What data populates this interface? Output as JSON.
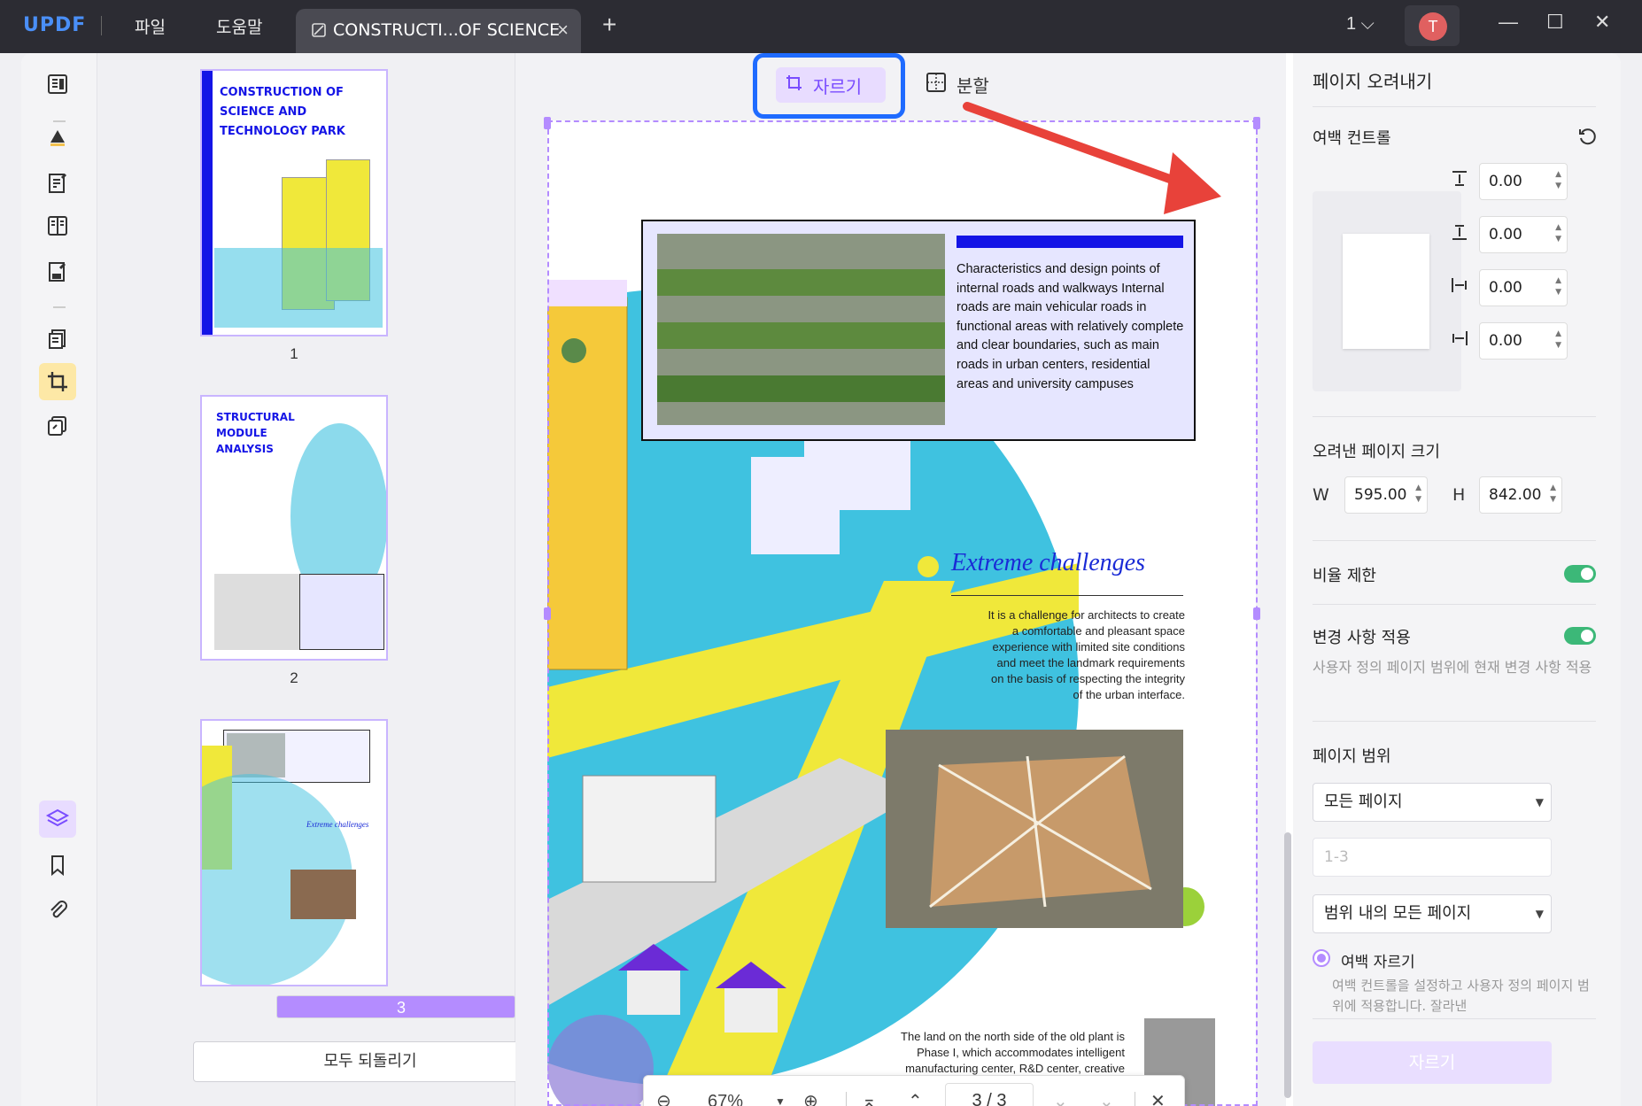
{
  "app": {
    "logo_u": "UPDF",
    "menu": [
      "파일",
      "도움말"
    ],
    "tab_title": "CONSTRUCTI...OF SCIENCE",
    "page_selector": "1",
    "avatar_letter": "T"
  },
  "toolbar": {
    "crop_label": "자르기",
    "split_label": "분할"
  },
  "thumbnails": {
    "pages": [
      {
        "number": "1",
        "title": "CONSTRUCTION OF SCIENCE AND TECHNOLOGY PARK"
      },
      {
        "number": "2",
        "title": "STRUCTURAL MODULE ANALYSIS"
      },
      {
        "number": "3",
        "title": ""
      }
    ],
    "selected": 3,
    "reset_all_label": "모두 되돌리기"
  },
  "document": {
    "box_text": "Characteristics and design points of internal roads and walkways Internal roads are main vehicular roads in functional areas with relatively complete and clear boundaries, such as main roads in urban centers, residential areas and university campuses",
    "challenge_title": "Extreme challenges",
    "challenge_text": "It is a challenge for architects to create a comfortable and pleasant space experience with limited site conditions and meet the landmark requirements on the basis of respecting the integrity of the urban interface.",
    "bottom_text": "The land on the north side of the old plant is Phase I, which accommodates intelligent manufacturing center, R&D center, creative"
  },
  "zoombar": {
    "zoom": "67%",
    "current_page": "3",
    "separator": "/",
    "total_pages": "3"
  },
  "panel": {
    "title": "페이지 오려내기",
    "margin_control": "여백 컨트롤",
    "margins": {
      "top": "0.00",
      "bottom": "0.00",
      "left": "0.00",
      "right": "0.00"
    },
    "cropped_size_label": "오려낸 페이지 크기",
    "w_label": "W",
    "w_value": "595.00",
    "h_label": "H",
    "h_value": "842.00",
    "ratio_lock_label": "비율 제한",
    "ratio_lock_on": true,
    "apply_changes_label": "변경 사항 적용",
    "apply_changes_on": true,
    "apply_changes_desc": "사용자 정의 페이지 범위에 현재 변경 사항 적용",
    "page_range_label": "페이지 범위",
    "range_select": "모든 페이지",
    "range_input_placeholder": "1-3",
    "range_subset": "범위 내의 모든 페이지",
    "margin_crop_label": "여백 자르기",
    "margin_crop_desc": "여백 컨트롤을 설정하고 사용자 정의 페이지 범위에 적용합니다. 잘라낸",
    "crop_button": "자르기"
  },
  "colors": {
    "accent": "#b48cff",
    "highlight_frame": "#1f6bff",
    "arrow": "#e8423a",
    "toggle_on": "#3cb878"
  }
}
